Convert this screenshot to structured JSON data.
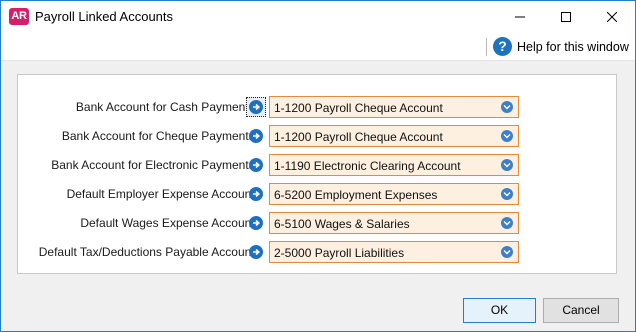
{
  "window": {
    "title": "Payroll Linked Accounts",
    "app_icon_text": "AR",
    "help_label": "Help for this window"
  },
  "rows": [
    {
      "label": "Bank Account for Cash Payments:",
      "value": "1-1200 Payroll Cheque Account"
    },
    {
      "label": "Bank Account for Cheque Payments:",
      "value": "1-1200 Payroll Cheque Account"
    },
    {
      "label": "Bank Account for Electronic Payments:",
      "value": "1-1190 Electronic Clearing Account"
    },
    {
      "label": "Default Employer Expense Account:",
      "value": "6-5200 Employment Expenses"
    },
    {
      "label": "Default Wages Expense Account:",
      "value": "6-5100 Wages & Salaries"
    },
    {
      "label": "Default Tax/Deductions Payable Account:",
      "value": "2-5000 Payroll Liabilities"
    }
  ],
  "buttons": {
    "ok": "OK",
    "cancel": "Cancel"
  },
  "colors": {
    "combo_fill": "#fdf0e0",
    "combo_border": "#e58a3a",
    "accent": "#1f6fc2"
  },
  "icons": {
    "app": "accountright-logo-icon",
    "help": "help-icon",
    "row_link": "arrow-right-circle-icon",
    "dropdown": "chevron-down-circle-icon"
  }
}
